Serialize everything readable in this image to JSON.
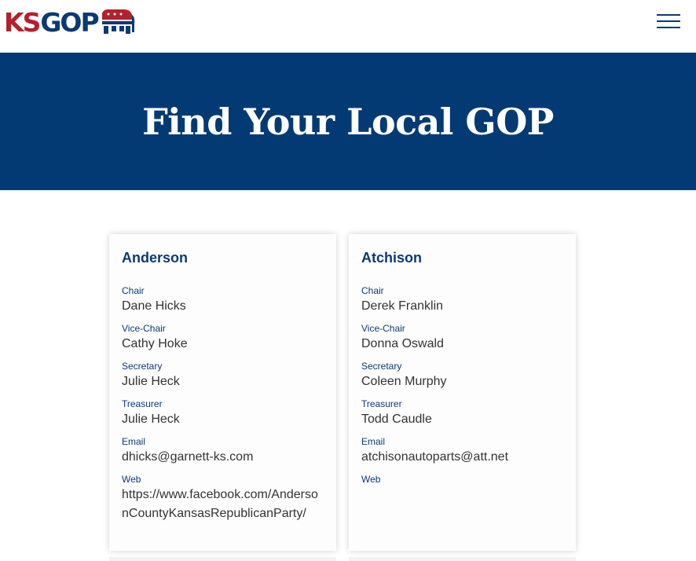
{
  "logo": {
    "ks": "KS",
    "gop": "GOP",
    "colors": {
      "red": "#b5202e",
      "blue": "#0a3a73"
    }
  },
  "header": {
    "menu_icon": "hamburger-menu-icon"
  },
  "hero": {
    "title": "Find Your Local GOP",
    "background": "#033a74"
  },
  "cards": [
    {
      "county": "Anderson",
      "fields": [
        {
          "label": "Chair",
          "value": "Dane Hicks"
        },
        {
          "label": "Vice-Chair",
          "value": "Cathy Hoke"
        },
        {
          "label": "Secretary",
          "value": "Julie Heck"
        },
        {
          "label": "Treasurer",
          "value": "Julie Heck"
        },
        {
          "label": "Email",
          "value": "dhicks@garnett-ks.com"
        },
        {
          "label": "Web",
          "value": "https://www.facebook.com/AndersonCountyKansasRepublicanParty/"
        }
      ]
    },
    {
      "county": "Atchison",
      "fields": [
        {
          "label": "Chair",
          "value": "Derek Franklin"
        },
        {
          "label": "Vice-Chair",
          "value": "Donna Oswald"
        },
        {
          "label": "Secretary",
          "value": "Coleen Murphy"
        },
        {
          "label": "Treasurer",
          "value": "Todd Caudle"
        },
        {
          "label": "Email",
          "value": "atchisonautoparts@att.net"
        },
        {
          "label": "Web",
          "value": ""
        }
      ]
    }
  ]
}
